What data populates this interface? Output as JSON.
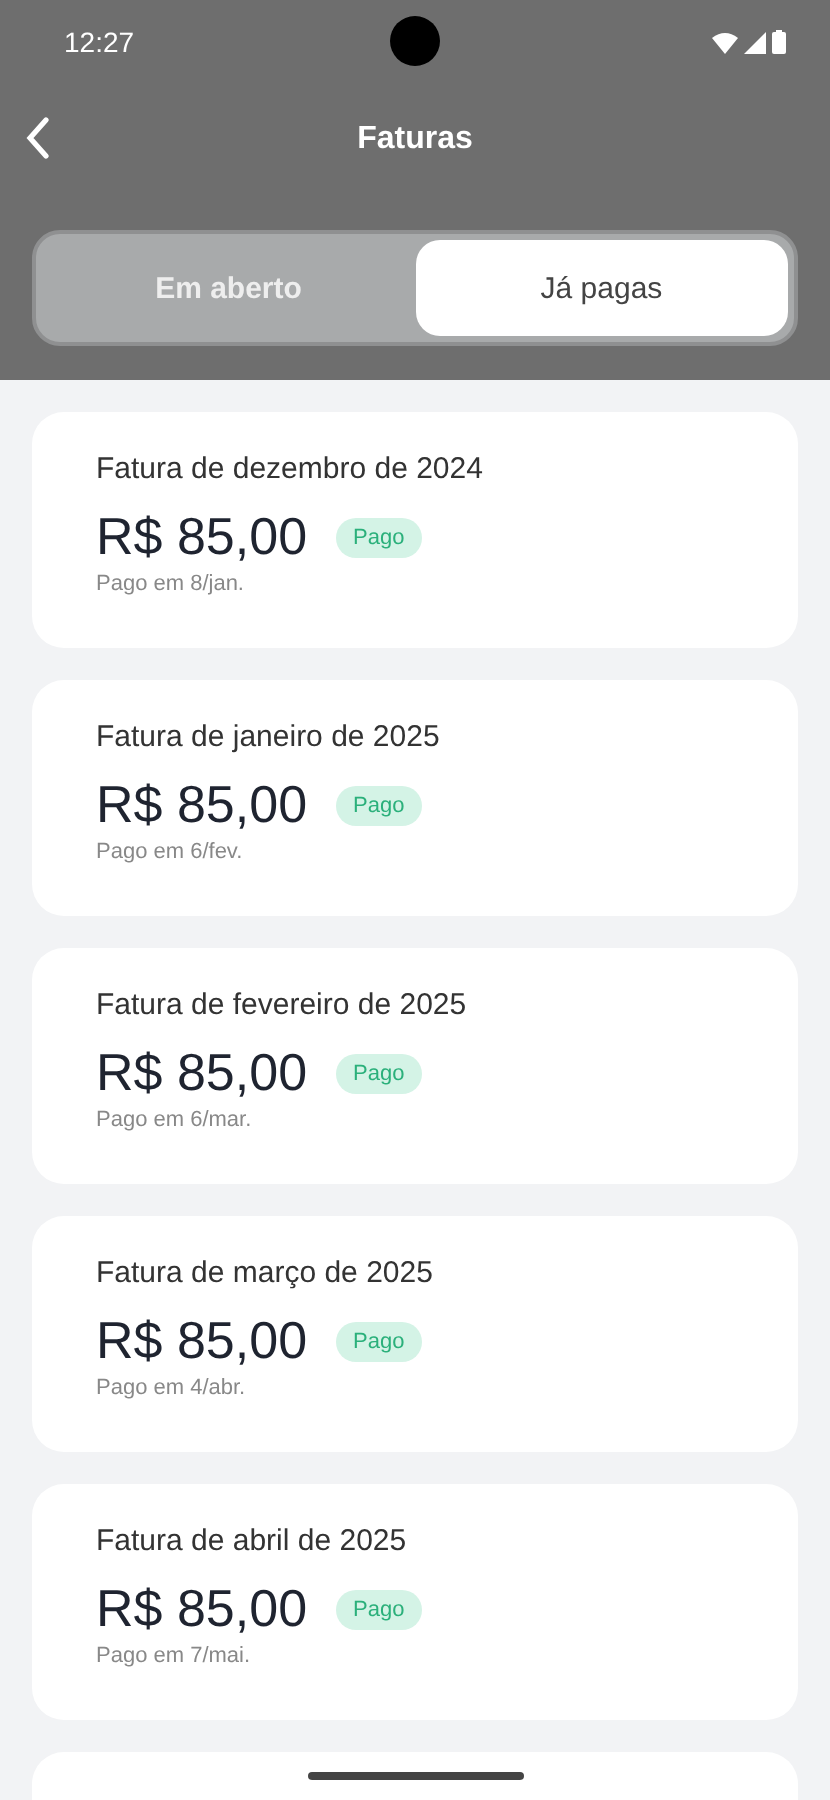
{
  "status_bar": {
    "time": "12:27"
  },
  "header": {
    "title": "Faturas"
  },
  "tabs": [
    {
      "label": "Em aberto",
      "selected": false
    },
    {
      "label": "Já pagas",
      "selected": true
    }
  ],
  "invoices": [
    {
      "title": "Fatura de dezembro de 2024",
      "amount": "R$ 85,00",
      "badge": "Pago",
      "paid_on": "Pago em 8/jan."
    },
    {
      "title": "Fatura de janeiro de 2025",
      "amount": "R$ 85,00",
      "badge": "Pago",
      "paid_on": "Pago em 6/fev."
    },
    {
      "title": "Fatura de fevereiro de 2025",
      "amount": "R$ 85,00",
      "badge": "Pago",
      "paid_on": "Pago em 6/mar."
    },
    {
      "title": "Fatura de março de 2025",
      "amount": "R$ 85,00",
      "badge": "Pago",
      "paid_on": "Pago em 4/abr."
    },
    {
      "title": "Fatura de abril de 2025",
      "amount": "R$ 85,00",
      "badge": "Pago",
      "paid_on": "Pago em 7/mai."
    }
  ]
}
